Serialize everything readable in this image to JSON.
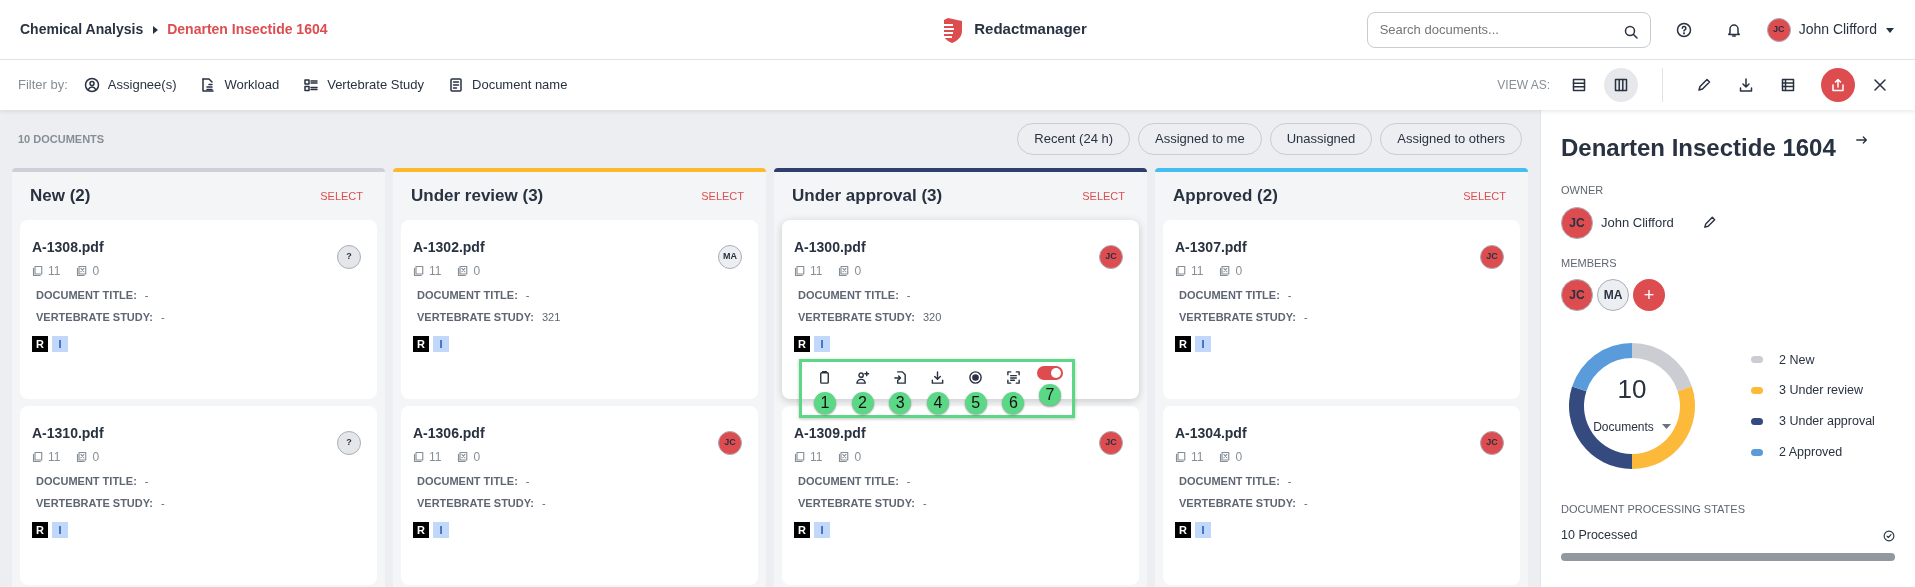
{
  "breadcrumb": [
    {
      "label": "Chemical Analysis",
      "current": false
    },
    {
      "label": "Denarten Insectide 1604",
      "current": true
    }
  ],
  "app_name": "Redactmanager",
  "search": {
    "placeholder": "Search documents..."
  },
  "user": {
    "initials": "JC",
    "name": "John Clifford"
  },
  "filter_bar": {
    "label": "Filter by:",
    "filters": [
      {
        "kind": "assignee",
        "label": "Assignee(s)"
      },
      {
        "kind": "workload",
        "label": "Workload"
      },
      {
        "kind": "list",
        "label": "Vertebrate Study"
      },
      {
        "kind": "document",
        "label": "Document name"
      }
    ]
  },
  "view_as": {
    "label": "VIEW AS:",
    "options": [
      {
        "kind": "list",
        "selected": false
      },
      {
        "kind": "board",
        "selected": true
      }
    ]
  },
  "document_count": "10 DOCUMENTS",
  "quick_filters": [
    {
      "label": "Recent (24 h)"
    },
    {
      "label": "Assigned to me"
    },
    {
      "label": "Unassigned"
    },
    {
      "label": "Assigned to others"
    }
  ],
  "columns": [
    {
      "title": "New (2)",
      "color": "#cdd0d6",
      "select": "SELECT",
      "cards": [
        {
          "name": "A-1308.pdf",
          "pages": "11",
          "excluded": "0",
          "fields": [
            {
              "label": "DOCUMENT TITLE:",
              "value": "-"
            },
            {
              "label": "VERTEBRATE STUDY:",
              "value": "-"
            }
          ],
          "assignee": {
            "initials": "?",
            "color": "#e4e6ea"
          },
          "tags": [
            {
              "label": "R",
              "color": "#000000"
            },
            {
              "label": "I",
              "color": "#c2d8fb"
            }
          ],
          "hovered": false
        },
        {
          "name": "A-1310.pdf",
          "pages": "11",
          "excluded": "0",
          "fields": [
            {
              "label": "DOCUMENT TITLE:",
              "value": "-"
            },
            {
              "label": "VERTEBRATE STUDY:",
              "value": "-"
            }
          ],
          "assignee": {
            "initials": "?",
            "color": "#e4e6ea"
          },
          "tags": [
            {
              "label": "R",
              "color": "#000000"
            },
            {
              "label": "I",
              "color": "#c2d8fb"
            }
          ],
          "hovered": false
        }
      ]
    },
    {
      "title": "Under review (3)",
      "color": "#fdb92c",
      "select": "SELECT",
      "cards": [
        {
          "name": "A-1302.pdf",
          "pages": "11",
          "excluded": "0",
          "fields": [
            {
              "label": "DOCUMENT TITLE:",
              "value": "-"
            },
            {
              "label": "VERTEBRATE STUDY:",
              "value": "321"
            }
          ],
          "assignee": {
            "initials": "MA",
            "color": "#eceef2"
          },
          "tags": [
            {
              "label": "R",
              "color": "#000000"
            },
            {
              "label": "I",
              "color": "#c2d8fb"
            }
          ],
          "hovered": false
        },
        {
          "name": "A-1306.pdf",
          "pages": "11",
          "excluded": "0",
          "fields": [
            {
              "label": "DOCUMENT TITLE:",
              "value": "-"
            },
            {
              "label": "VERTEBRATE STUDY:",
              "value": "-"
            }
          ],
          "assignee": {
            "initials": "JC",
            "color": "#dd4d50"
          },
          "tags": [
            {
              "label": "R",
              "color": "#000000"
            },
            {
              "label": "I",
              "color": "#c2d8fb"
            }
          ],
          "hovered": false
        }
      ]
    },
    {
      "title": "Under approval (3)",
      "color": "#2f3e6e",
      "select": "SELECT",
      "cards": [
        {
          "name": "A-1300.pdf",
          "pages": "11",
          "excluded": "0",
          "fields": [
            {
              "label": "DOCUMENT TITLE:",
              "value": "-"
            },
            {
              "label": "VERTEBRATE STUDY:",
              "value": "320"
            }
          ],
          "assignee": {
            "initials": "JC",
            "color": "#dd4d50"
          },
          "tags": [
            {
              "label": "R",
              "color": "#000000"
            },
            {
              "label": "I",
              "color": "#c2d8fb"
            }
          ],
          "hovered": true,
          "actions": [
            {
              "kind": "delete",
              "marker": "1"
            },
            {
              "kind": "assign",
              "marker": "2"
            },
            {
              "kind": "import",
              "marker": "3"
            },
            {
              "kind": "download",
              "marker": "4"
            },
            {
              "kind": "record",
              "marker": "5"
            },
            {
              "kind": "scan",
              "marker": "6"
            },
            {
              "kind": "toggle",
              "on": true,
              "marker": "7"
            }
          ]
        },
        {
          "name": "A-1309.pdf",
          "pages": "11",
          "excluded": "0",
          "fields": [
            {
              "label": "DOCUMENT TITLE:",
              "value": "-"
            },
            {
              "label": "VERTEBRATE STUDY:",
              "value": "-"
            }
          ],
          "assignee": {
            "initials": "JC",
            "color": "#dd4d50"
          },
          "tags": [
            {
              "label": "R",
              "color": "#000000"
            },
            {
              "label": "I",
              "color": "#c2d8fb"
            }
          ],
          "hovered": false
        }
      ]
    },
    {
      "title": "Approved (2)",
      "color": "#45bdf0",
      "select": "SELECT",
      "cards": [
        {
          "name": "A-1307.pdf",
          "pages": "11",
          "excluded": "0",
          "fields": [
            {
              "label": "DOCUMENT TITLE:",
              "value": "-"
            },
            {
              "label": "VERTEBRATE STUDY:",
              "value": "-"
            }
          ],
          "assignee": {
            "initials": "JC",
            "color": "#dd4d50"
          },
          "tags": [
            {
              "label": "R",
              "color": "#000000"
            },
            {
              "label": "I",
              "color": "#c2d8fb"
            }
          ],
          "hovered": false
        },
        {
          "name": "A-1304.pdf",
          "pages": "11",
          "excluded": "0",
          "fields": [
            {
              "label": "DOCUMENT TITLE:",
              "value": "-"
            },
            {
              "label": "VERTEBRATE STUDY:",
              "value": "-"
            }
          ],
          "assignee": {
            "initials": "JC",
            "color": "#dd4d50"
          },
          "tags": [
            {
              "label": "R",
              "color": "#000000"
            },
            {
              "label": "I",
              "color": "#c2d8fb"
            }
          ],
          "hovered": false
        }
      ]
    }
  ],
  "details": {
    "title": "Denarten Insectide 1604",
    "owner_label": "OWNER",
    "owner": {
      "initials": "JC",
      "name": "John Clifford"
    },
    "members_label": "MEMBERS",
    "members": [
      {
        "kind": "member",
        "initials": "JC",
        "color": "#dd4d50"
      },
      {
        "kind": "member",
        "initials": "MA",
        "color": "#eceef2"
      },
      {
        "kind": "add",
        "initials": "+",
        "color": "#dd4d50"
      }
    ],
    "total": "10",
    "unit": "Documents",
    "chart_data": {
      "type": "donut",
      "values": [
        20,
        30,
        30,
        20
      ]
    },
    "legend": [
      {
        "label": "2 New",
        "color": "#cccdd2"
      },
      {
        "label": "3 Under review",
        "color": "#fdb93a"
      },
      {
        "label": "3 Under approval",
        "color": "#354a7e"
      },
      {
        "label": "2 Approved",
        "color": "#5a9bdc"
      }
    ],
    "processing_label": "DOCUMENT PROCESSING STATES",
    "processing": {
      "label": "10 Processed",
      "level": 1
    }
  }
}
